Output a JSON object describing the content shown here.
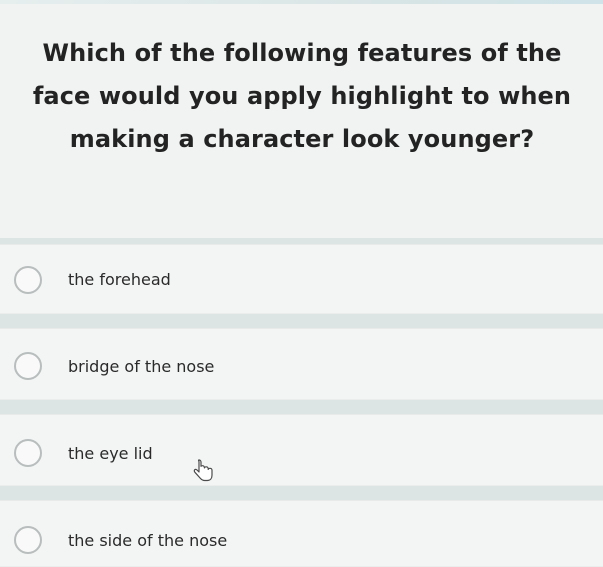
{
  "question": {
    "text": "Which of the following features of the face would you apply highlight to when making a character look younger?"
  },
  "options": [
    {
      "label": "the forehead"
    },
    {
      "label": "bridge of the nose"
    },
    {
      "label": "the eye lid"
    },
    {
      "label": "the side of the nose"
    }
  ],
  "colors": {
    "background": "#eef2f1",
    "option_background": "#f3f5f4",
    "text": "#232323",
    "radio_border": "#b8bdbd"
  },
  "icons": {
    "cursor": "hand-pointer-icon"
  }
}
